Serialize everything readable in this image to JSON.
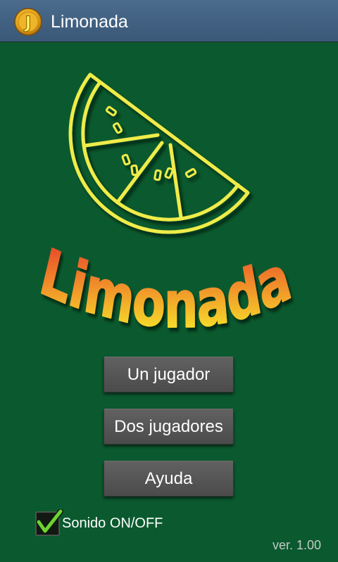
{
  "action_bar": {
    "title": "Limonada",
    "app_icon": {
      "name": "app-logo-icon",
      "letter": "J"
    }
  },
  "logo": {
    "icon": "lemon-slice-icon",
    "text": "Limonada"
  },
  "menu": {
    "buttons": [
      {
        "label": "Un jugador"
      },
      {
        "label": "Dos jugadores"
      },
      {
        "label": "Ayuda"
      }
    ]
  },
  "sound_toggle": {
    "label": "Sonido ON/OFF",
    "checked": true,
    "icon": "check-icon"
  },
  "version": "ver. 1.00",
  "colors": {
    "background": "#0b5a2f",
    "action_bar": "#3f5e7e",
    "button": "#555555",
    "button_text": "#ffffff",
    "check": "#6fd232",
    "lemon_outline": "#efec4a",
    "logo_text_top": "#e63a2a",
    "logo_text_bottom": "#f6e02a",
    "version_text": "#c3cbc6"
  }
}
